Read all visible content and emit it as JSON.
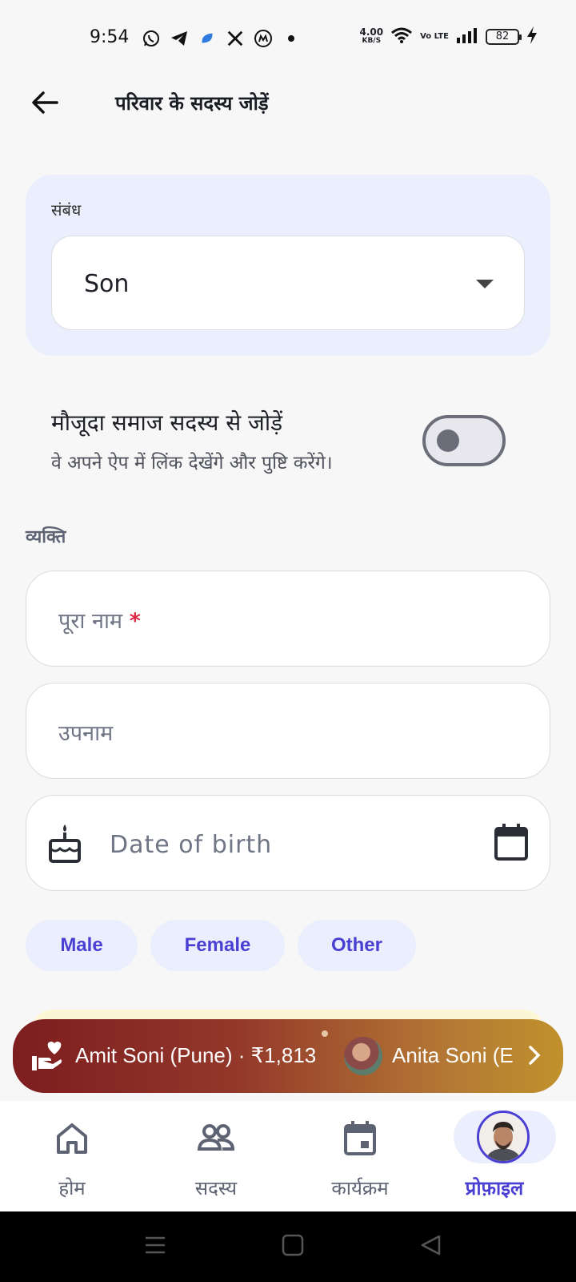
{
  "status_bar": {
    "time": "9:54",
    "net_speed_value": "4.00",
    "net_speed_unit": "KB/S",
    "volte": "Vo LTE",
    "battery": "82"
  },
  "header": {
    "title": "परिवार के सदस्य जोड़ें",
    "back_icon": "arrow-left-icon"
  },
  "relation": {
    "label": "संबंध",
    "value": "Son"
  },
  "link_member": {
    "title": "मौजूदा समाज सदस्य से जोड़ें",
    "subtitle": "वे अपने ऐप में लिंक देखेंगे और पुष्टि करेंगे।",
    "enabled": false
  },
  "person": {
    "section_label": "व्यक्ति",
    "full_name_placeholder": "पूरा नाम",
    "required_mark": "*",
    "nickname_placeholder": "उपनाम",
    "dob_placeholder": "Date of birth"
  },
  "gender": {
    "options": [
      "Male",
      "Female",
      "Other"
    ]
  },
  "ticker": {
    "item1": "Amit Soni (Pune) · ₹1,813",
    "item2": "Anita Soni (E"
  },
  "bottom_nav": {
    "items": [
      {
        "label": "होम",
        "icon": "home-icon"
      },
      {
        "label": "सदस्य",
        "icon": "members-icon"
      },
      {
        "label": "कार्यक्रम",
        "icon": "calendar-event-icon"
      },
      {
        "label": "प्रोफ़ाइल",
        "icon": "profile-avatar"
      }
    ],
    "active_index": 3
  },
  "colors": {
    "accent": "#4a3fd3",
    "card_bg": "#ebeefc",
    "required": "#e02445",
    "ticker_start": "#7d1d1f",
    "ticker_end": "#c0912c"
  }
}
